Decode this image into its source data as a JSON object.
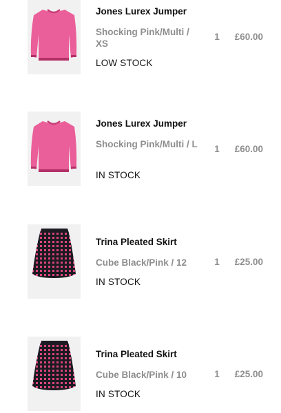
{
  "cart": {
    "items": [
      {
        "name": "Jones Lurex Jumper",
        "variant": "Shocking Pink/Multi / XS",
        "quantity": "1",
        "price": "£60.00",
        "stock": "LOW STOCK",
        "image": "pink-jumper"
      },
      {
        "name": "Jones Lurex Jumper",
        "variant": "Shocking Pink/Multi / L",
        "quantity": "1",
        "price": "£60.00",
        "stock": "IN STOCK",
        "image": "pink-jumper"
      },
      {
        "name": "Trina Pleated Skirt",
        "variant": "Cube Black/Pink / 12",
        "quantity": "1",
        "price": "£25.00",
        "stock": "IN STOCK",
        "image": "black-pink-pleated-skirt"
      },
      {
        "name": "Trina Pleated Skirt",
        "variant": "Cube Black/Pink / 10",
        "quantity": "1",
        "price": "£25.00",
        "stock": "IN STOCK",
        "image": "black-pink-pleated-skirt"
      }
    ]
  },
  "colors": {
    "jumper_pink": "#ea5f99",
    "skirt_black": "#1c1a22",
    "skirt_pink": "#d9467a"
  }
}
